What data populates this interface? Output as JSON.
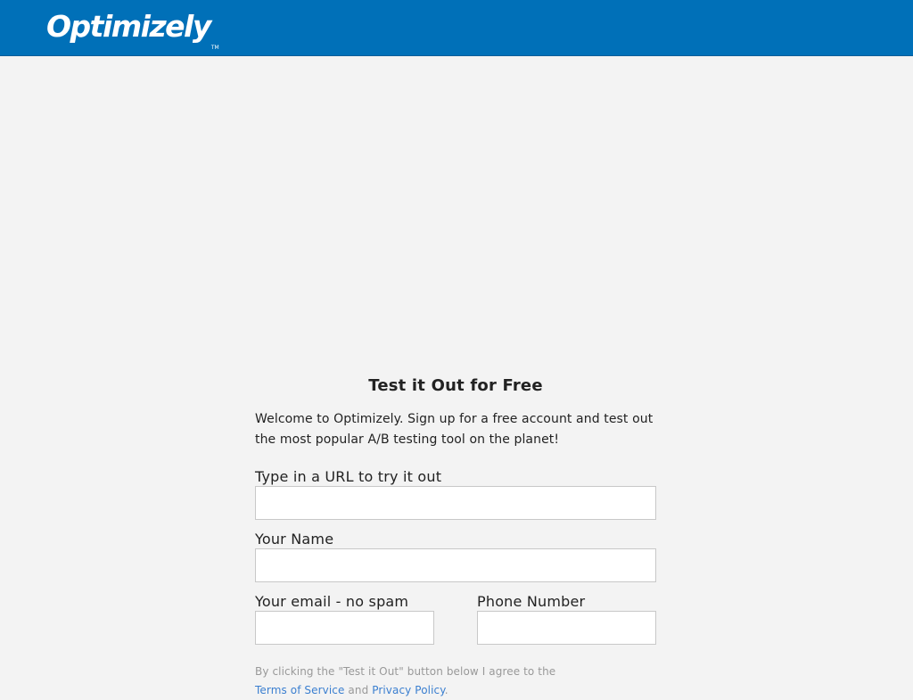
{
  "header": {
    "logo_text": "Optimizely",
    "logo_tm": "TM",
    "background_color": "#0070b8"
  },
  "form": {
    "title": "Test it Out for Free",
    "intro": "Welcome to Optimizely. Sign up for a free account and test out the most popular A/B testing tool on the planet!",
    "url_label": "Type in a URL to try it out",
    "url_value": "",
    "name_label": "Your Name",
    "name_value": "",
    "email_label": "Your email - no spam",
    "email_value": "",
    "phone_label": "Phone Number",
    "phone_value": "",
    "legal_prefix": "By clicking the \"Test it Out\" button below I agree to the",
    "terms_link": "Terms of Service",
    "legal_and": "and",
    "privacy_link": "Privacy Policy",
    "legal_suffix": ".",
    "link_color": "#3b7fd0"
  }
}
